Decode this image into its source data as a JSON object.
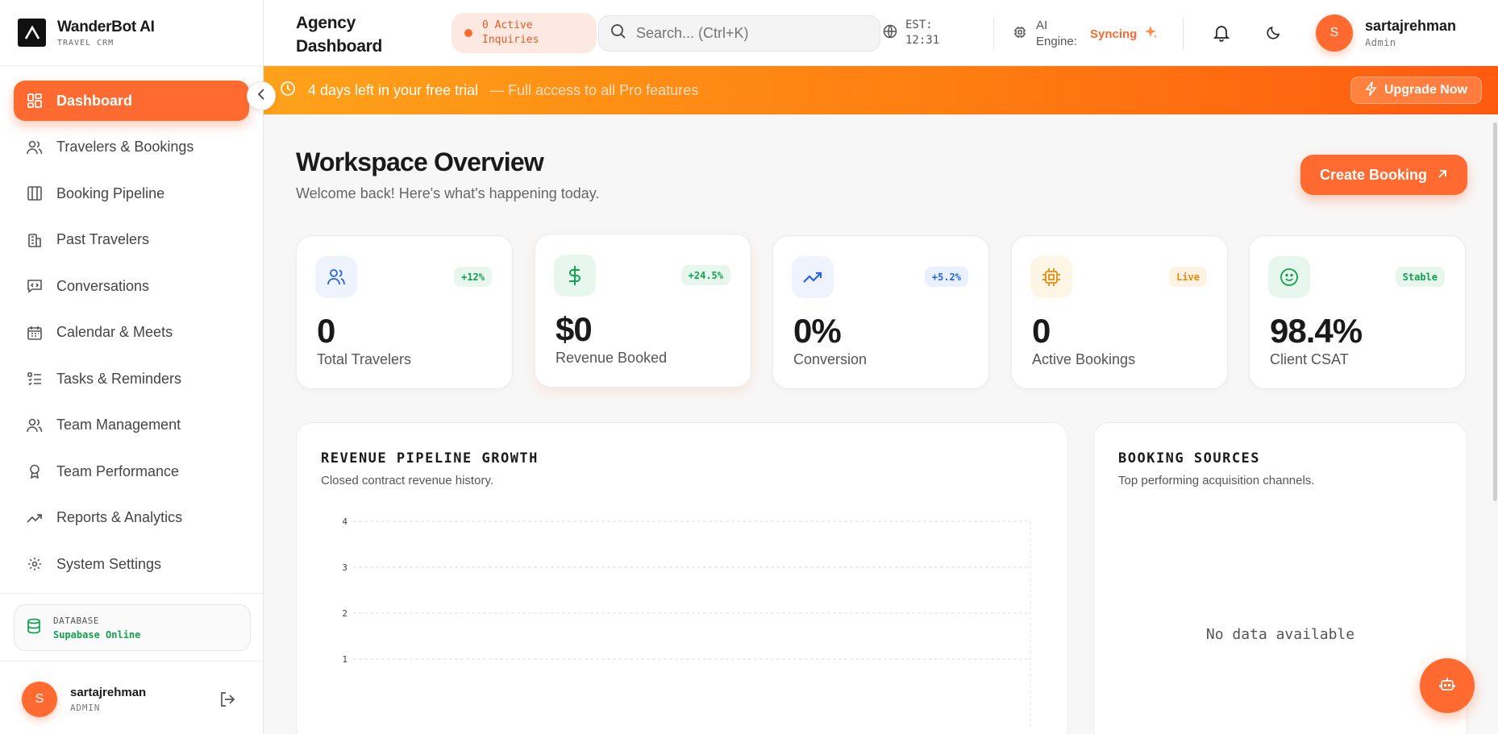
{
  "brand": {
    "name": "WanderBot AI",
    "subtitle": "TRAVEL CRM"
  },
  "sidebar": {
    "items": [
      {
        "label": "Dashboard",
        "icon": "dashboard-grid-icon",
        "active": true
      },
      {
        "label": "Travelers & Bookings",
        "icon": "users-icon"
      },
      {
        "label": "Booking Pipeline",
        "icon": "columns-icon"
      },
      {
        "label": "Past Travelers",
        "icon": "building-icon"
      },
      {
        "label": "Conversations",
        "icon": "message-code-icon"
      },
      {
        "label": "Calendar & Meets",
        "icon": "calendar-icon"
      },
      {
        "label": "Tasks & Reminders",
        "icon": "list-checks-icon"
      },
      {
        "label": "Team Management",
        "icon": "team-icon"
      },
      {
        "label": "Team Performance",
        "icon": "award-icon"
      },
      {
        "label": "Reports & Analytics",
        "icon": "trending-up-icon"
      },
      {
        "label": "System Settings",
        "icon": "gear-icon"
      }
    ],
    "database": {
      "label": "DATABASE",
      "status": "Supabase Online"
    },
    "user": {
      "initial": "S",
      "name": "sartajrehman",
      "role": "ADMIN"
    }
  },
  "header": {
    "title": "Agency Dashboard",
    "inquiries": "0 Active Inquiries",
    "search_placeholder": "Search... (Ctrl+K)",
    "clock": "EST: 12:31",
    "ai_label": "AI Engine:",
    "ai_status": "Syncing",
    "user": {
      "initial": "S",
      "name": "sartajrehman",
      "role": "Admin"
    }
  },
  "trial": {
    "main": "4 days left in your free trial",
    "sub": "— Full access to all Pro features",
    "button": "Upgrade Now"
  },
  "overview": {
    "title": "Workspace Overview",
    "subtitle": "Welcome back! Here's what's happening today.",
    "create_button": "Create Booking"
  },
  "stats": [
    {
      "value": "0",
      "label": "Total Travelers",
      "badge": "+12%",
      "icon": "users-icon"
    },
    {
      "value": "$0",
      "label": "Revenue Booked",
      "badge": "+24.5%",
      "icon": "dollar-icon"
    },
    {
      "value": "0%",
      "label": "Conversion",
      "badge": "+5.2%",
      "icon": "trending-up-icon"
    },
    {
      "value": "0",
      "label": "Active Bookings",
      "badge": "Live",
      "icon": "cpu-icon"
    },
    {
      "value": "98.4%",
      "label": "Client CSAT",
      "badge": "Stable",
      "icon": "smile-icon"
    }
  ],
  "colors": {
    "accent": "#ff6a30",
    "success": "#12a150",
    "info": "#2563eb",
    "warning": "#ea8a0c"
  },
  "revenue_panel": {
    "title": "REVENUE PIPELINE GROWTH",
    "subtitle": "Closed contract revenue history."
  },
  "sources_panel": {
    "title": "BOOKING SOURCES",
    "subtitle": "Top performing acquisition channels.",
    "empty": "No data available"
  },
  "chart_data": {
    "type": "area",
    "title": "REVENUE PIPELINE GROWTH",
    "x": [],
    "series": [],
    "ytick_labels": [
      "4",
      "3",
      "2",
      "1"
    ],
    "ylim": [
      0,
      4
    ],
    "grid": true
  }
}
